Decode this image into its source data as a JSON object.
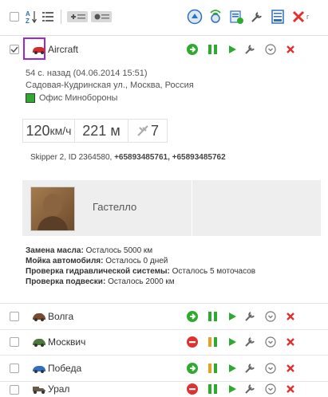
{
  "toolbar": {
    "left_icons": [
      "select-all-checkbox",
      "sort-az-icon",
      "list-icon",
      "add-group-icon",
      "toggle-view-icon"
    ],
    "right_icons": [
      "track-icon",
      "signal-icon",
      "commands-icon",
      "settings-wrench-icon",
      "report-icon",
      "delete-icon"
    ]
  },
  "selected_unit": {
    "name": "Aircraft",
    "last_seen": "54 с. назад (04.06.2014 15:51)",
    "address": "Садовая-Кудринская ул., Москва, Россия",
    "geofence": "Офис Минобороны",
    "speed": "120",
    "speed_unit": "км/ч",
    "altitude": "221 м",
    "satellites": "7",
    "device_prefix": "Skipper 2, ID 2364580, ",
    "phones": "+65893485761, +65893485762",
    "driver_name": "Гастелло",
    "maintenance": [
      {
        "label": "Замена масла:",
        "value": " Осталось 5000 км"
      },
      {
        "label": "Мойка автомобиля:",
        "value": " Осталось 0 дней"
      },
      {
        "label": "Проверка гидравлической системы:",
        "value": " Осталось 5 моточасов"
      },
      {
        "label": "Проверка подвески:",
        "value": " Осталось 2000 км"
      }
    ]
  },
  "units": [
    {
      "name": "Волга",
      "status": "green",
      "ignition": "green"
    },
    {
      "name": "Москвич",
      "status": "red",
      "ignition": "mixed"
    },
    {
      "name": "Победа",
      "status": "green",
      "ignition": "mixed"
    },
    {
      "name": "Урал",
      "status": "red",
      "ignition": "green"
    }
  ],
  "colors": {
    "accent_blue": "#2f6fbf",
    "green": "#2eaa2e",
    "red": "#e03030",
    "selection_outline": "#9b27d8"
  }
}
